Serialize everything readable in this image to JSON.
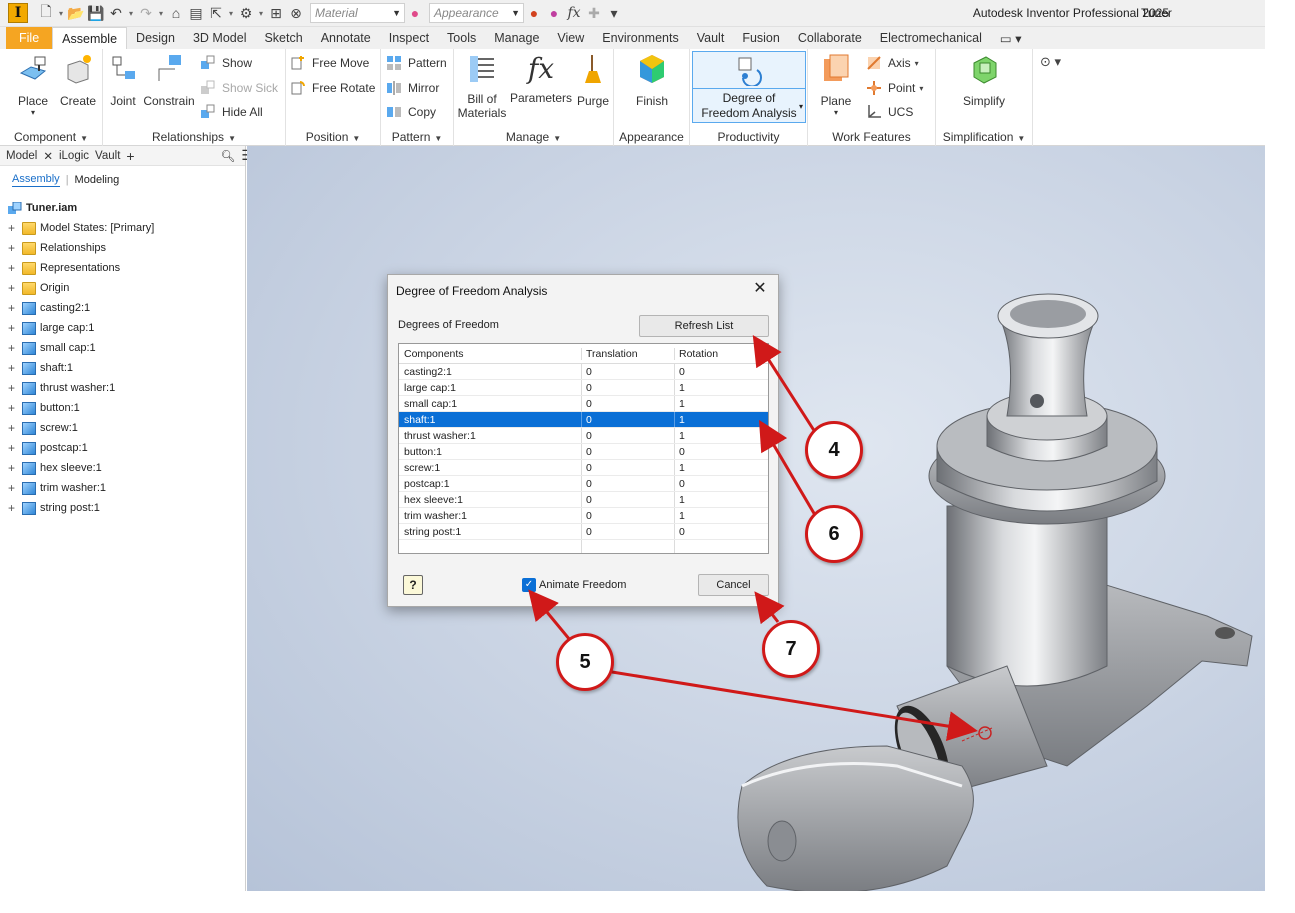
{
  "app": {
    "logo": "I",
    "title": "Autodesk Inventor Professional 2025",
    "document": "Tuner",
    "material_placeholder": "Material",
    "appearance_placeholder": "Appearance"
  },
  "tabs": [
    "File",
    "Assemble",
    "Design",
    "3D Model",
    "Sketch",
    "Annotate",
    "Inspect",
    "Tools",
    "Manage",
    "View",
    "Environments",
    "Vault",
    "Fusion",
    "Collaborate",
    "Electromechanical"
  ],
  "active_tab": "Assemble",
  "ribbon": {
    "component": {
      "title": "Component",
      "place": "Place",
      "create": "Create"
    },
    "relationships": {
      "title": "Relationships",
      "joint": "Joint",
      "constrain": "Constrain",
      "show": "Show",
      "show_sick": "Show Sick",
      "hide_all": "Hide All"
    },
    "position": {
      "title": "Position",
      "free_move": "Free Move",
      "free_rotate": "Free Rotate"
    },
    "pattern": {
      "title": "Pattern",
      "pattern": "Pattern",
      "mirror": "Mirror",
      "copy": "Copy"
    },
    "manage": {
      "title": "Manage",
      "bom_line1": "Bill of",
      "bom_line2": "Materials",
      "parameters": "Parameters",
      "purge": "Purge"
    },
    "appearance": {
      "title": "Appearance",
      "finish": "Finish"
    },
    "productivity": {
      "title": "Productivity",
      "dof_line1": "Degree of",
      "dof_line2": "Freedom Analysis"
    },
    "work_features": {
      "title": "Work Features",
      "plane": "Plane",
      "axis": "Axis",
      "point": "Point",
      "ucs": "UCS"
    },
    "simplification": {
      "title": "Simplification",
      "simplify": "Simplify"
    }
  },
  "browser": {
    "tabs": [
      "Model",
      "iLogic",
      "Vault"
    ],
    "sub_tabs": [
      "Assembly",
      "Modeling"
    ],
    "root": "Tuner.iam",
    "items": [
      {
        "label": "Model States: [Primary]",
        "icon": "folder"
      },
      {
        "label": "Relationships",
        "icon": "folder"
      },
      {
        "label": "Representations",
        "icon": "folder"
      },
      {
        "label": "Origin",
        "icon": "folder"
      },
      {
        "label": "casting2:1",
        "icon": "part"
      },
      {
        "label": "large cap:1",
        "icon": "part"
      },
      {
        "label": "small cap:1",
        "icon": "part"
      },
      {
        "label": "shaft:1",
        "icon": "part"
      },
      {
        "label": "thrust washer:1",
        "icon": "part"
      },
      {
        "label": "button:1",
        "icon": "part"
      },
      {
        "label": "screw:1",
        "icon": "part"
      },
      {
        "label": "postcap:1",
        "icon": "part"
      },
      {
        "label": "hex sleeve:1",
        "icon": "part"
      },
      {
        "label": "trim washer:1",
        "icon": "part"
      },
      {
        "label": "string post:1",
        "icon": "part"
      }
    ]
  },
  "dialog": {
    "title": "Degree of Freedom Analysis",
    "section": "Degrees of Freedom",
    "refresh": "Refresh List",
    "columns": [
      "Components",
      "Translation",
      "Rotation"
    ],
    "rows": [
      [
        "casting2:1",
        "0",
        "0"
      ],
      [
        "large cap:1",
        "0",
        "1"
      ],
      [
        "small cap:1",
        "0",
        "1"
      ],
      [
        "shaft:1",
        "0",
        "1"
      ],
      [
        "thrust washer:1",
        "0",
        "1"
      ],
      [
        "button:1",
        "0",
        "0"
      ],
      [
        "screw:1",
        "0",
        "1"
      ],
      [
        "postcap:1",
        "0",
        "0"
      ],
      [
        "hex sleeve:1",
        "0",
        "1"
      ],
      [
        "trim washer:1",
        "0",
        "1"
      ],
      [
        "string post:1",
        "0",
        "0"
      ]
    ],
    "selected_row": "shaft:1",
    "animate_label": "Animate Freedom",
    "animate_checked": true,
    "cancel": "Cancel",
    "help": "?"
  },
  "callouts": [
    "4",
    "5",
    "6",
    "7"
  ],
  "colors": {
    "accent": "#0a6fd6",
    "file_tab": "#f5a522",
    "callout": "#d01919"
  }
}
